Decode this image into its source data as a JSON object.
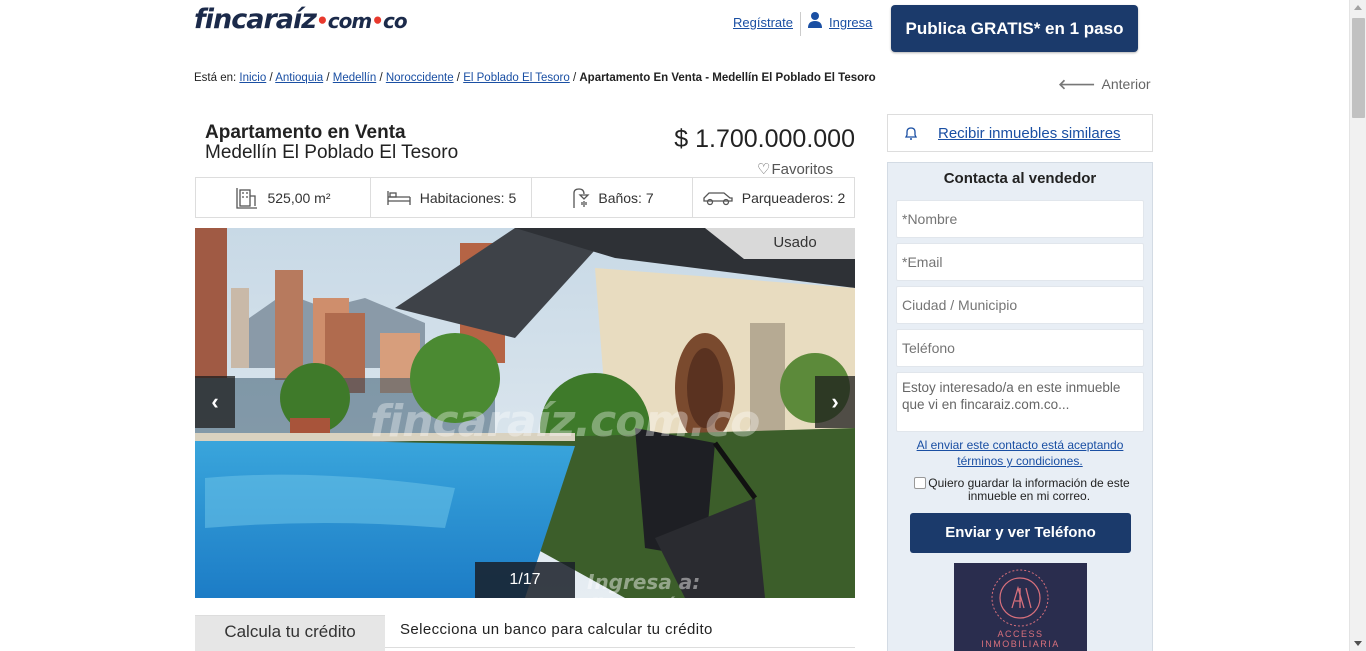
{
  "header": {
    "logo_main": "fincaraíz",
    "logo_com": "com",
    "logo_co": "co",
    "register_label": "Regístrate",
    "login_label": "Ingresa",
    "publish_label": "Publica GRATIS* en 1 paso"
  },
  "breadcrumb": {
    "prefix": "Está en:",
    "items": [
      "Inicio",
      "Antioquia",
      "Medellín",
      "Noroccidente",
      "El Poblado El Tesoro"
    ],
    "current": "Apartamento En Venta - Medellín El Poblado El Tesoro",
    "separator": " / "
  },
  "back_label": "Anterior",
  "listing": {
    "title": "Apartamento en Venta",
    "location": "Medellín El Poblado El Tesoro",
    "price": "$ 1.700.000.000",
    "favorites_label": "Favoritos",
    "features": [
      {
        "icon": "area-icon",
        "text": "525,00 m²"
      },
      {
        "icon": "bed-icon",
        "text": "Habitaciones: 5"
      },
      {
        "icon": "shower-icon",
        "text": "Baños: 7"
      },
      {
        "icon": "car-icon",
        "text": "Parqueaderos: 2"
      }
    ]
  },
  "gallery": {
    "badge": "Usado",
    "counter": "1/17",
    "watermark": "fincaraíz.com.co",
    "watermark_bottom": "Ingresa a: fincaraíz.com.co"
  },
  "credit": {
    "tab_label": "Calcula tu crédito",
    "text": "Selecciona un banco para calcular tu crédito"
  },
  "alerts": {
    "link_label": "Recibir inmuebles similares"
  },
  "contact": {
    "title": "Contacta al vendedor",
    "name_placeholder": "*Nombre",
    "email_placeholder": "*Email",
    "city_placeholder": "Ciudad / Municipio",
    "phone_placeholder": "Teléfono",
    "message_value": "Estoy interesado/a en este inmueble que vi en fincaraiz.com.co...",
    "terms_line1": "Al enviar este contacto está aceptando",
    "terms_line2": "términos y condiciones.",
    "save_label": "Quiero guardar la información de este inmueble en mi correo.",
    "send_label": "Enviar y ver Teléfono",
    "agency_name_line1": "ACCESS",
    "agency_name_line2": "INMOBILIARIA"
  },
  "colors": {
    "brand_dark": "#1b3a6b",
    "brand_accent": "#e8392d",
    "link": "#1a4fa3",
    "contact_bg": "#e8eef5"
  }
}
